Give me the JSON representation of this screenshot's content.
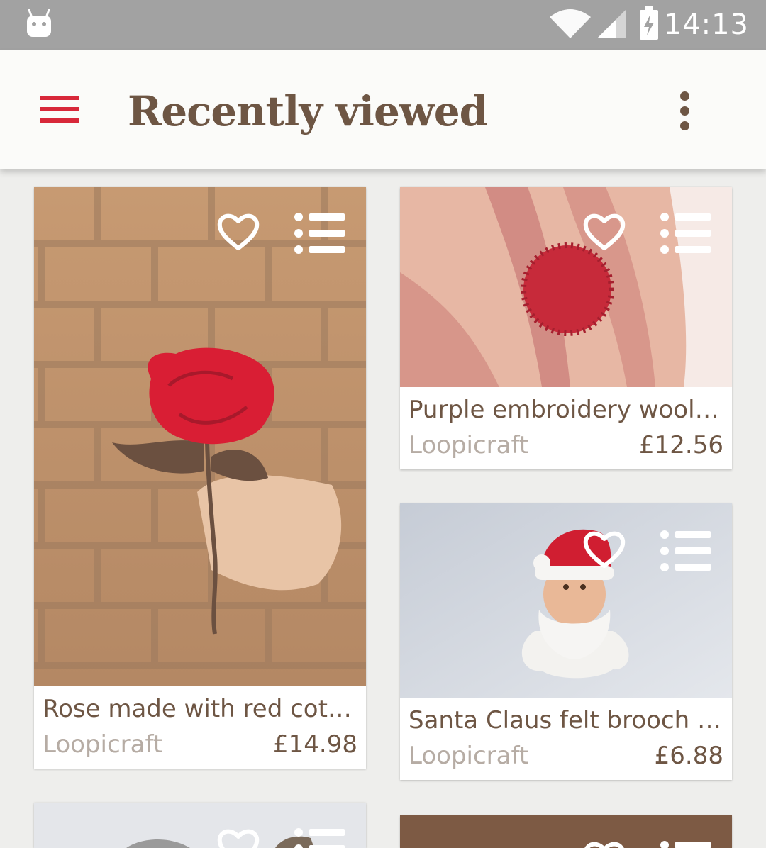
{
  "status_bar": {
    "time": "14:13",
    "icons": [
      "android-icon",
      "wifi-icon",
      "signal-icon",
      "battery-charging-icon"
    ]
  },
  "app_bar": {
    "title": "Recently viewed",
    "icons": [
      "menu-icon",
      "overflow-menu-icon"
    ],
    "accent_color": "#d8283a",
    "title_color": "#6e5644"
  },
  "products": [
    {
      "name": "Rose made with red cotto…",
      "seller": "Loopicraft",
      "price": "£14.98"
    },
    {
      "name": "Purple embroidery wool f…",
      "seller": "Loopicraft",
      "price": "£12.56"
    },
    {
      "name": "Santa Claus felt brooch or…",
      "seller": "Loopicraft",
      "price": "£6.88"
    }
  ],
  "card_icons": [
    "heart-icon",
    "list-icon"
  ]
}
